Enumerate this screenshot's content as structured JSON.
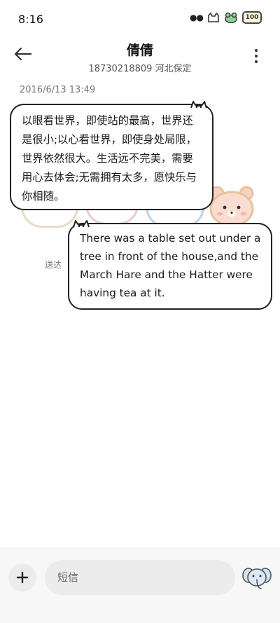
{
  "status_bar": {
    "time": "8:16",
    "battery_level": "100"
  },
  "header": {
    "contact_name": "倩倩",
    "contact_subtitle": "18730218809 河北保定"
  },
  "conversation": {
    "timestamp": "2016/6/13 13:49",
    "messages": [
      {
        "direction": "incoming",
        "text": "以眼看世界，即使站的最高，世界还是很小;以心看世界，即使身处局限，世界依然很大。生活远不完美，需要用心去体会;无需拥有太多，愿快乐与你相随。"
      },
      {
        "direction": "outgoing",
        "text": "There was a table set out under a tree in front of the house,and the March Hare and the Hatter were having tea at it."
      }
    ],
    "sent_status": "送达"
  },
  "composer": {
    "placeholder": "短信"
  },
  "icons": {
    "back": "arrow-left-icon",
    "more": "more-vertical-icon",
    "add": "plus-icon",
    "send": "elephant-send-icon"
  }
}
